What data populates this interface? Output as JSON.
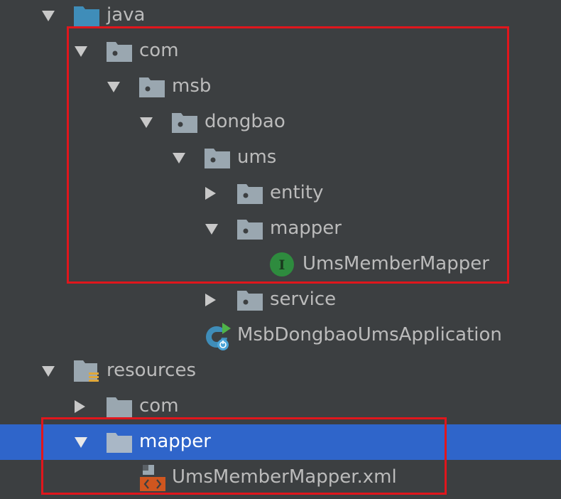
{
  "tree": [
    {
      "label": "java",
      "icon": "source-folder-icon",
      "arrow": "expanded"
    },
    {
      "label": "com",
      "icon": "package-icon",
      "arrow": "expanded"
    },
    {
      "label": "msb",
      "icon": "package-icon",
      "arrow": "expanded"
    },
    {
      "label": "dongbao",
      "icon": "package-icon",
      "arrow": "expanded"
    },
    {
      "label": "ums",
      "icon": "package-icon",
      "arrow": "expanded"
    },
    {
      "label": "entity",
      "icon": "package-icon",
      "arrow": "collapsed"
    },
    {
      "label": "mapper",
      "icon": "package-icon",
      "arrow": "expanded"
    },
    {
      "label": "UmsMemberMapper",
      "icon": "interface-icon",
      "arrow": "none",
      "icon_letter": "I"
    },
    {
      "label": "service",
      "icon": "package-icon",
      "arrow": "collapsed"
    },
    {
      "label": "MsbDongbaoUmsApplication",
      "icon": "spring-boot-application-icon",
      "arrow": "none"
    },
    {
      "label": "resources",
      "icon": "resources-folder-icon",
      "arrow": "expanded"
    },
    {
      "label": "com",
      "icon": "folder-icon",
      "arrow": "collapsed"
    },
    {
      "label": "mapper",
      "icon": "folder-icon",
      "arrow": "expanded",
      "selected": true
    },
    {
      "label": "UmsMemberMapper.xml",
      "icon": "xml-file-icon",
      "arrow": "none"
    }
  ],
  "colors": {
    "background": "#3c3f41",
    "selection": "#2f65ca",
    "text": "#bbbbbb",
    "highlight_border": "#e0161c",
    "source_folder": "#3f8db9",
    "package_folder": "#9aa7b0",
    "interface_icon": "#2e8b3e",
    "xml_icon": "#d0561f"
  }
}
